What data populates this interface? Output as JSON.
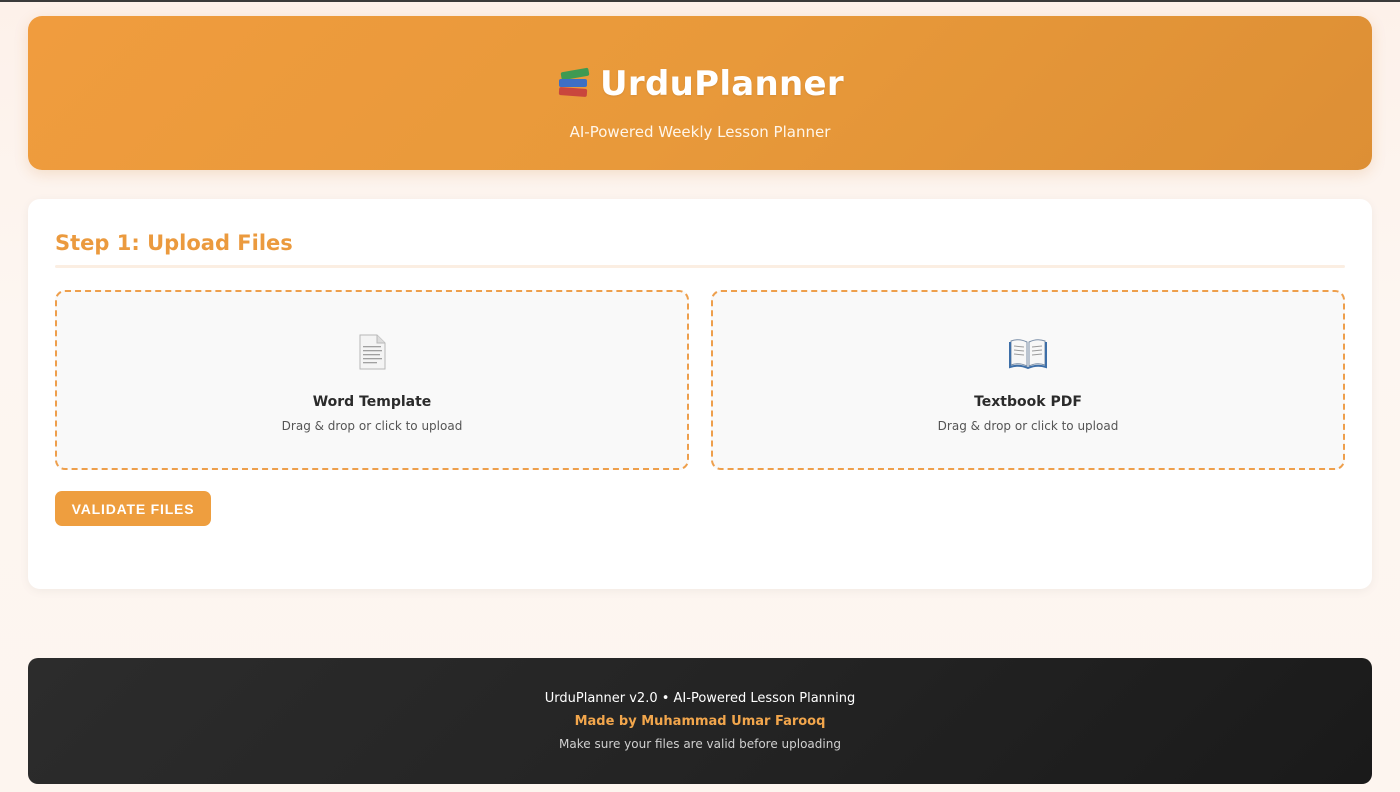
{
  "header": {
    "title": "UrduPlanner",
    "subtitle": "AI-Powered Weekly Lesson Planner",
    "icon": "books-icon"
  },
  "step1": {
    "title": "Step 1: Upload Files",
    "dropzones": [
      {
        "label": "Word Template",
        "hint": "Drag & drop or click to upload",
        "icon": "document-icon"
      },
      {
        "label": "Textbook PDF",
        "hint": "Drag & drop or click to upload",
        "icon": "open-book-icon"
      }
    ],
    "validate_label": "VALIDATE FILES"
  },
  "footer": {
    "line1": "UrduPlanner v2.0 • AI-Powered Lesson Planning",
    "line2": "Made by Muhammad Umar Farooq",
    "line3": "Make sure your files are valid before uploading"
  },
  "colors": {
    "accent": "#ee9e3f",
    "header_bg": "#e8993a",
    "footer_bg": "#242424",
    "footer_highlight": "#f2a64c"
  }
}
